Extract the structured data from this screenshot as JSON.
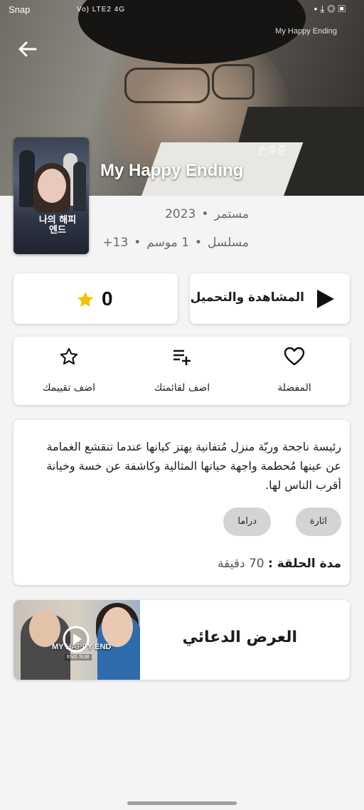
{
  "status_bar": {
    "left_text": "Snap",
    "network_text": "Vo) LTE2 4G",
    "right_icons": [
      "notification-dot-icon",
      "download-icon",
      "screen-record-icon",
      "gallery-icon"
    ],
    "watermark": "My Happy Ending"
  },
  "hero": {
    "title": "My Happy Ending",
    "korean_caption": "손호준",
    "poster_title": "나의 해피엔드"
  },
  "meta": {
    "year": "2023",
    "status": "مستمر",
    "type": "مسلسل",
    "seasons": "1 موسم",
    "age": "+13"
  },
  "rating": {
    "value": "0",
    "icon": "star-icon",
    "color": "#f4c400"
  },
  "watch": {
    "label": "المشاهدة والتحميل",
    "icon": "play-icon"
  },
  "actions": {
    "favorite": "المفضلة",
    "add_list": "اضف لقائمتك",
    "add_rating": "اضف تقييمك"
  },
  "description": {
    "text": "رئيسة ناجحة وربّة منزل مُتفانية يهتز كيانها عندما تنقشع الغمامة عن عينها مُحطمة واجهة حياتها المثالية وكاشفة عن خسة وخيانة أقرب الناس لها.",
    "genres": [
      "اثارة",
      "دراما"
    ],
    "duration_label": "مدة الحلقة :",
    "duration_value": "70 دقيقة"
  },
  "trailer": {
    "label": "العرض الدعائي",
    "thumb_overlay": "MY HAPPY END",
    "thumb_sub": "ENG SUB"
  }
}
